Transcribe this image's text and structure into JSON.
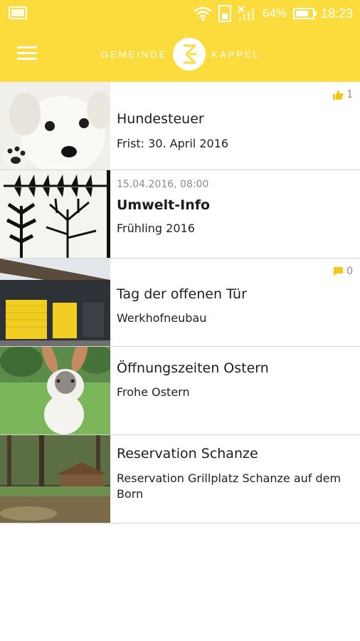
{
  "status_bar": {
    "battery_percent": "64%",
    "time": "18:23",
    "icons": [
      "gallery-icon",
      "wifi-icon",
      "sim-icon",
      "signal-icon",
      "battery-icon"
    ]
  },
  "app_bar": {
    "brand_left": "GEMEINDE",
    "brand_right": "KAPPEL",
    "menu_icon": "hamburger-menu-icon"
  },
  "colors": {
    "accent": "#fcdb3c",
    "divider": "#d6d6d6",
    "meta": "#8a8a8a"
  },
  "news": [
    {
      "title": "Hundesteuer",
      "subtitle": "Frist: 30. April 2016",
      "badge_icon": "thumbs-up-icon",
      "badge_count": "1",
      "image": "puppy-photo"
    },
    {
      "date": "15.04.2016, 08:00",
      "title": "Umwelt-Info",
      "subtitle": "Frühling 2016",
      "image": "plant-graphic"
    },
    {
      "title": "Tag der offenen Tür",
      "subtitle": "Werkhofneubau",
      "badge_icon": "comment-icon",
      "badge_count": "0",
      "image": "building-photo"
    },
    {
      "title": "Öffnungszeiten Ostern",
      "subtitle": "Frohe Ostern",
      "image": "rabbit-photo"
    },
    {
      "title": "Reservation Schanze",
      "subtitle": "Reservation Grillplatz Schanze auf dem Born",
      "image": "forest-photo"
    }
  ]
}
